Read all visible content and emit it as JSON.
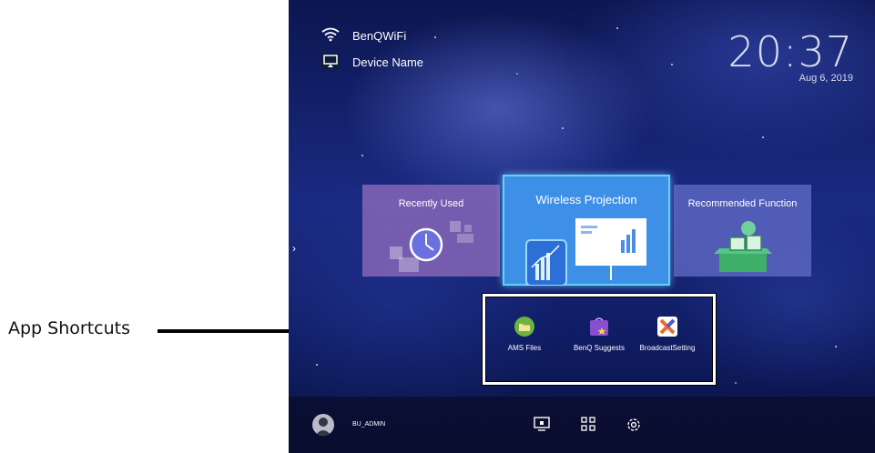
{
  "callout": {
    "label": "App Shortcuts"
  },
  "status": {
    "wifi_name": "BenQWiFi",
    "device_name": "Device Name"
  },
  "clock": {
    "time": "20:37",
    "date": "Aug 6, 2019"
  },
  "cards": {
    "recently_used": "Recently Used",
    "wireless_projection": "Wireless Projection",
    "recommended_function": "Recommended Function"
  },
  "apps": [
    {
      "label": "AMS Files",
      "icon": "folder-icon",
      "color": "#6db33f"
    },
    {
      "label": "BenQ Suggests",
      "icon": "shopping-bag-icon",
      "color": "#8a4fd0"
    },
    {
      "label": "BroadcastSetting",
      "icon": "broadcast-x-icon",
      "color": "#f06a2a"
    }
  ],
  "bottom_bar": {
    "username": "BU_ADMIN",
    "icons": [
      "user-avatar-icon",
      "screen-mirror-icon",
      "app-grid-icon",
      "settings-gear-icon"
    ]
  },
  "colors": {
    "accent": "#5fd3ff",
    "wireless_card": "#3e90e6",
    "recent_card": "#9a6ebe",
    "recommend_card": "#6e72c8"
  }
}
